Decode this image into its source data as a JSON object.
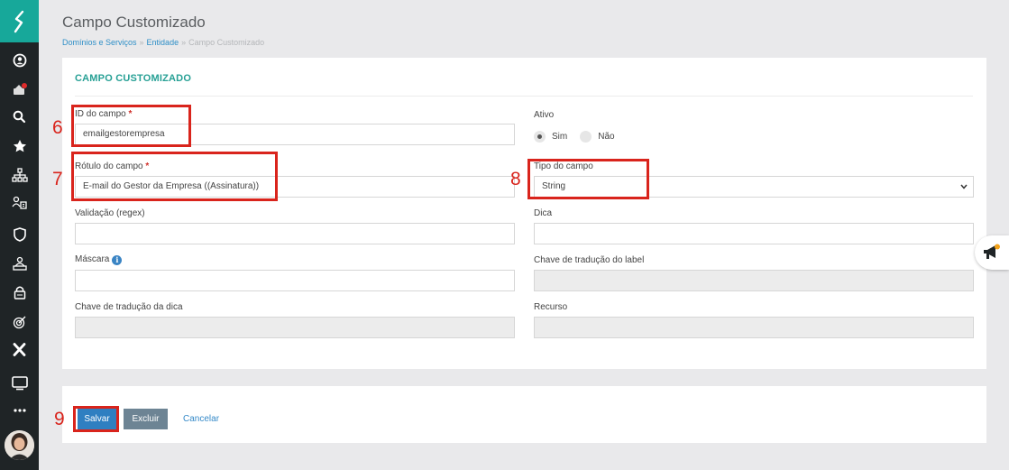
{
  "header": {
    "title": "Campo Customizado",
    "breadcrumb": [
      {
        "label": "Domínios e Serviços",
        "link": true
      },
      {
        "label": "Entidade",
        "link": true
      },
      {
        "label": "Campo Customizado",
        "link": false
      }
    ],
    "breadcrumb_separator": "»"
  },
  "form": {
    "section_title": "CAMPO CUSTOMIZADO",
    "id_label": "ID do campo",
    "id_value": "emailgestorempresa",
    "ativo_label": "Ativo",
    "radio_sim": "Sim",
    "radio_nao": "Não",
    "rotulo_label": "Rótulo do campo",
    "rotulo_value": "E-mail do Gestor da Empresa ((Assinatura))",
    "tipo_label": "Tipo do campo",
    "tipo_value": "String",
    "validacao_label": "Validação (regex)",
    "validacao_value": "",
    "dica_label": "Dica",
    "dica_value": "",
    "mascara_label": "Máscara",
    "mascara_value": "",
    "chave_label_label": "Chave de tradução do label",
    "chave_label_value": "",
    "chave_dica_label": "Chave de tradução da dica",
    "chave_dica_value": "",
    "recurso_label": "Recurso",
    "recurso_value": "",
    "required_mark": "*"
  },
  "actions": {
    "save_label": "Salvar",
    "delete_label": "Excluir",
    "cancel_label": "Cancelar"
  },
  "annotations": [
    "6",
    "7",
    "8",
    "9"
  ],
  "colors": {
    "accent": "#17a89a",
    "section_title": "#27a095",
    "annotation": "#d9241c",
    "save_button": "#2f7fc1",
    "delete_button": "#6d8494",
    "sidebar": "#1f2426"
  }
}
